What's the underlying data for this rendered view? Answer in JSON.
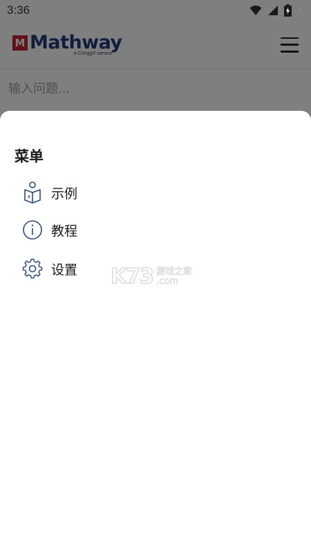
{
  "status_bar": {
    "time": "3:36",
    "icons": [
      "wifi-icon",
      "signal-icon",
      "battery-icon"
    ]
  },
  "header": {
    "logo_mark": "M",
    "logo_name": "Mathway",
    "logo_tagline": "a Chegg® service",
    "menu_icon": "hamburger-menu-icon"
  },
  "search": {
    "placeholder": "输入问题..."
  },
  "menu_sheet": {
    "title": "菜单",
    "items": [
      {
        "label": "示例",
        "icon": "book-person-icon"
      },
      {
        "label": "教程",
        "icon": "info-icon"
      },
      {
        "label": "设置",
        "icon": "gear-icon"
      }
    ]
  },
  "watermark": {
    "logo": "K73",
    "cn": "游戏之家",
    "domain": ".com"
  },
  "colors": {
    "brand_blue": "#1f3d7a",
    "brand_red": "#c0262d",
    "icon_blue": "#2b4a7a",
    "scrim": "rgba(0,0,0,0.5)"
  }
}
